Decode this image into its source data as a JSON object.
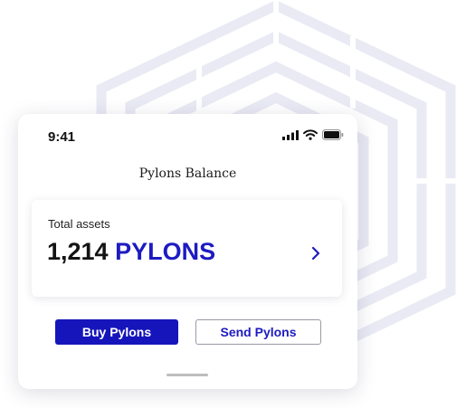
{
  "status_bar": {
    "time": "9:41"
  },
  "screen": {
    "title": "Pylons Balance"
  },
  "balance_card": {
    "label": "Total assets",
    "amount": "1,214",
    "unit": "PYLONS"
  },
  "actions": {
    "buy_label": "Buy Pylons",
    "send_label": "Send Pylons"
  },
  "colors": {
    "accent": "#1d1bc0",
    "button_primary": "#1515bb",
    "background_pattern": "#e8e9f4"
  },
  "icons": [
    "signal-icon",
    "wifi-icon",
    "battery-icon",
    "chevron-right-icon"
  ]
}
